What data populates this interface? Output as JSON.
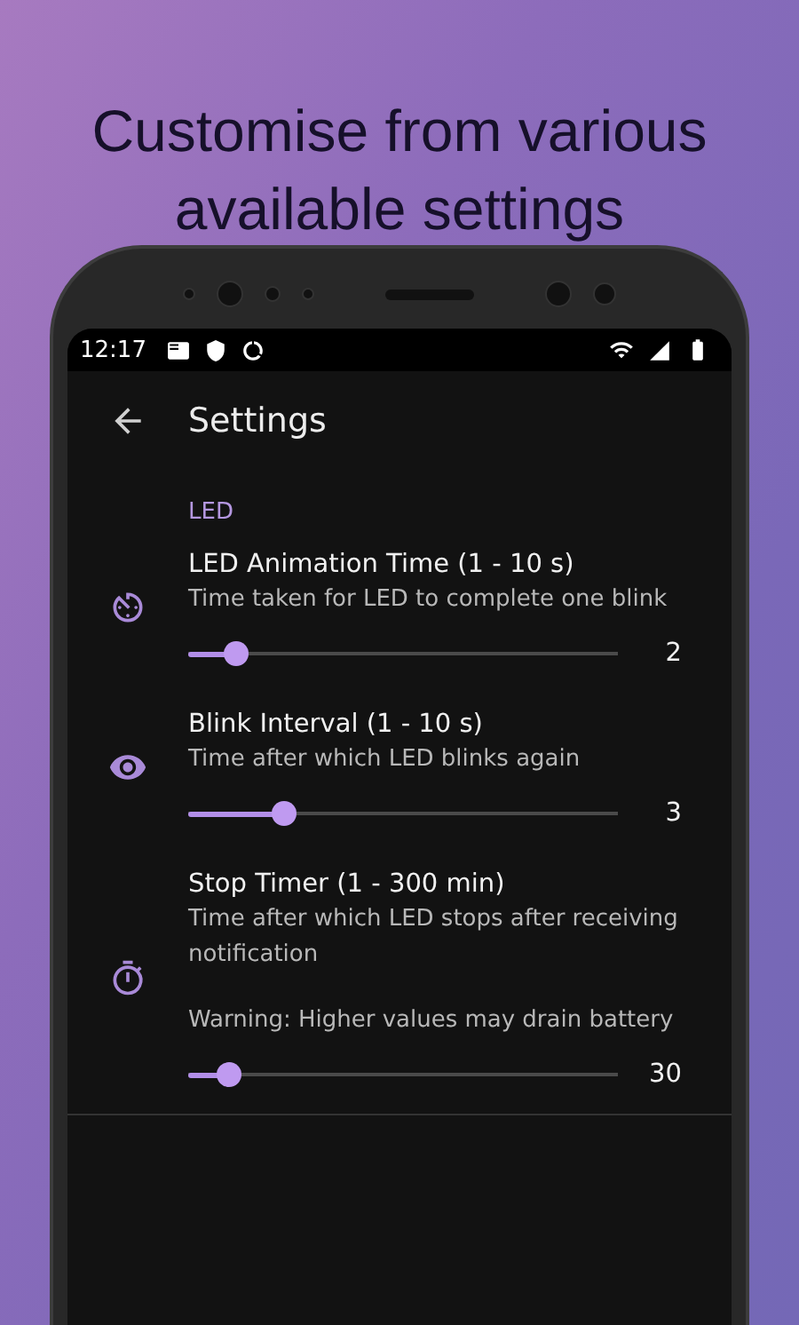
{
  "headline": [
    "Customise from various",
    "available settings"
  ],
  "status_bar": {
    "time": "12:17"
  },
  "app_bar": {
    "title": "Settings"
  },
  "section": {
    "title": "LED",
    "items": [
      {
        "kind": "timer",
        "title": "LED Animation Time (1 - 10 s)",
        "subtitle": "Time taken for LED to complete one blink",
        "level": 0.111,
        "reading": "2"
      },
      {
        "kind": "eye",
        "title": "Blink Interval (1 - 10 s)",
        "subtitle": "Time after which LED blinks again",
        "level": 0.222,
        "reading": "3"
      },
      {
        "kind": "stopwatch",
        "title": "Stop Timer (1 - 300 min)",
        "subtitle": "Time after which LED stops after receiving notification",
        "warning": "Warning: Higher values may drain battery",
        "level": 0.097,
        "reading": "30"
      }
    ]
  }
}
